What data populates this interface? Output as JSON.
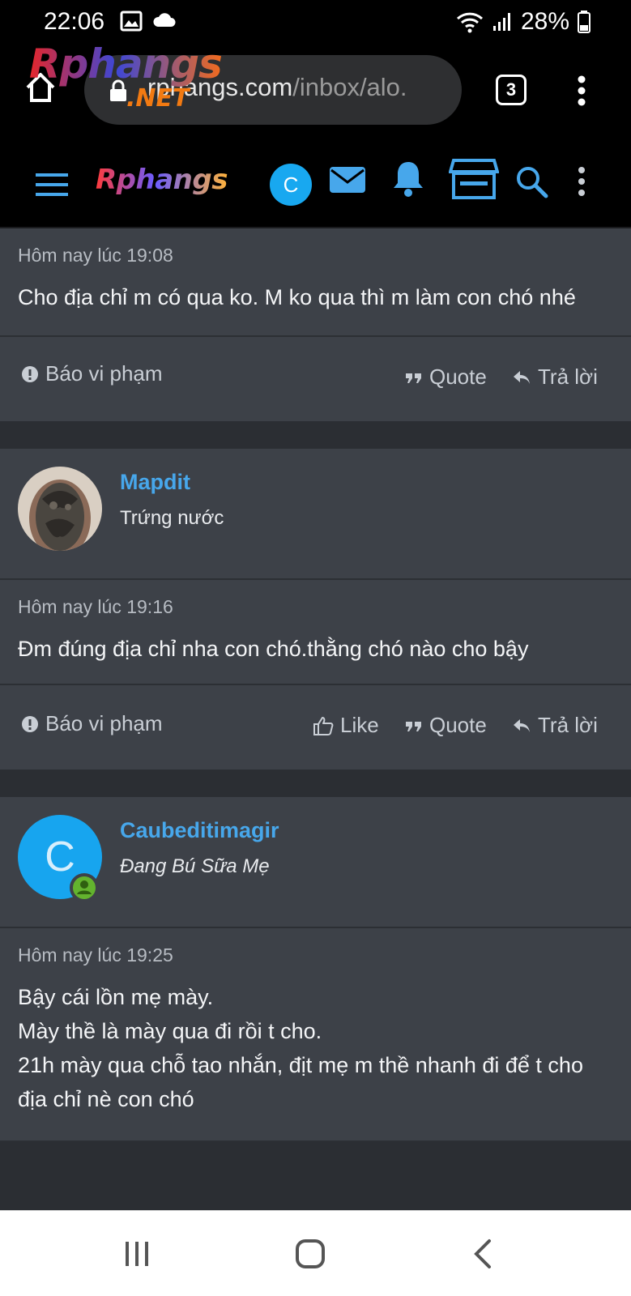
{
  "status_bar": {
    "time": "22:06",
    "battery": "28%"
  },
  "browser": {
    "url_main": "rphangs.com",
    "url_path": "/inbox/alo.",
    "tab_count": "3",
    "overlay_logo": "Rphangs",
    "overlay_logo_suffix": ".NET"
  },
  "site_nav": {
    "logo": "Rphangs",
    "avatar_letter": "C"
  },
  "messages": [
    {
      "time": "Hôm nay lúc 19:08",
      "body": "Cho địa chỉ m có qua ko. M ko qua thì m làm con chó nhé",
      "report": "Báo vi phạm",
      "quote": "Quote",
      "reply": "Trả lời"
    },
    {
      "author": "Mapdit",
      "author_title": "Trứng nước",
      "time": "Hôm nay lúc 19:16",
      "body": "Đm đúng địa chỉ nha con chó.thằng chó nào cho bậy",
      "report": "Báo vi phạm",
      "like": "Like",
      "quote": "Quote",
      "reply": "Trả lời"
    },
    {
      "author": "Caubeditimagir",
      "author_title": "Đang Bú Sữa Mẹ",
      "avatar_letter": "C",
      "time": "Hôm nay lúc 19:25",
      "body": "Bậy cái lồn mẹ mày.\nMày thề là mày qua đi rồi t cho.\n21h mày qua chỗ tao nhắn, địt mẹ m thề nhanh đi để t cho địa chỉ nè con chó"
    }
  ],
  "colors": {
    "accent": "#47a7eb",
    "card": "#3d4148",
    "page": "#2b2e33",
    "online": "#63b32e"
  }
}
